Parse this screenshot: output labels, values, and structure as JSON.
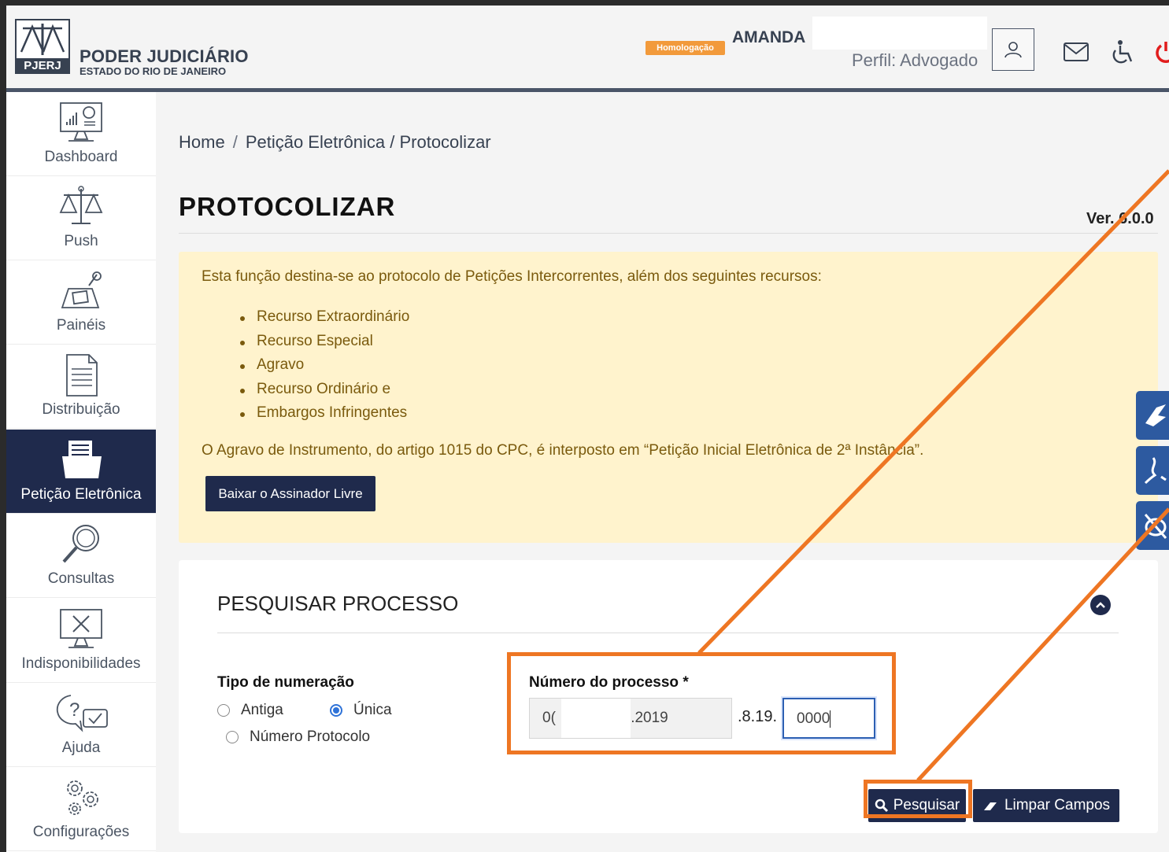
{
  "header": {
    "brand_title": "PODER JUDICIÁRIO",
    "brand_subtitle": "ESTADO DO RIO DE JANEIRO",
    "logo_text": "PJERJ",
    "env_badge": "Homologação",
    "user_name": "AMANDA",
    "user_profile": "Perfil: Advogado"
  },
  "sidebar": {
    "items": [
      {
        "label": "Dashboard",
        "icon": "dashboard-monitor-icon"
      },
      {
        "label": "Push",
        "icon": "scales-icon"
      },
      {
        "label": "Painéis",
        "icon": "panels-icon"
      },
      {
        "label": "Distribuição",
        "icon": "document-icon"
      },
      {
        "label": "Petição Eletrônica",
        "icon": "folder-document-icon",
        "active": true
      },
      {
        "label": "Consultas",
        "icon": "magnifier-icon"
      },
      {
        "label": "Indisponibilidades",
        "icon": "monitor-x-icon"
      },
      {
        "label": "Ajuda",
        "icon": "help-chat-icon"
      },
      {
        "label": "Configurações",
        "icon": "gears-icon"
      }
    ]
  },
  "breadcrumb": {
    "home": "Home",
    "separator": "/",
    "trail": "Petição Eletrônica / Protocolizar"
  },
  "page": {
    "title": "PROTOCOLIZAR",
    "version": "Ver. 6.0.0"
  },
  "notice": {
    "intro": "Esta função destina-se ao protocolo de Petições Intercorrentes, além dos seguintes recursos:",
    "items": [
      "Recurso Extraordinário",
      "Recurso Especial",
      "Agravo",
      "Recurso Ordinário e",
      "Embargos Infringentes"
    ],
    "note": "O Agravo de Instrumento, do artigo 1015 do CPC, é interposto em “Petição Inicial Eletrônica de 2ª Instância”.",
    "button_label": "Baixar o Assinador Livre"
  },
  "search_panel": {
    "title": "PESQUISAR PROCESSO",
    "numbering_label": "Tipo de numeração",
    "radio_antiga": "Antiga",
    "radio_unica": "Única",
    "radio_protocolo": "Número Protocolo",
    "selected": "Única",
    "process_label": "Número do processo *",
    "process_part1_prefix": "0(",
    "process_part1_suffix": ".2019",
    "process_mid": ".8.19.",
    "process_part2": "0000",
    "search_button": "Pesquisar",
    "clear_button": "Limpar Campos"
  },
  "colors": {
    "navy": "#1f2a4c",
    "accent_orange": "#ee7623",
    "notice_bg": "#fff3cd",
    "float_blue": "#2d5aa0"
  }
}
